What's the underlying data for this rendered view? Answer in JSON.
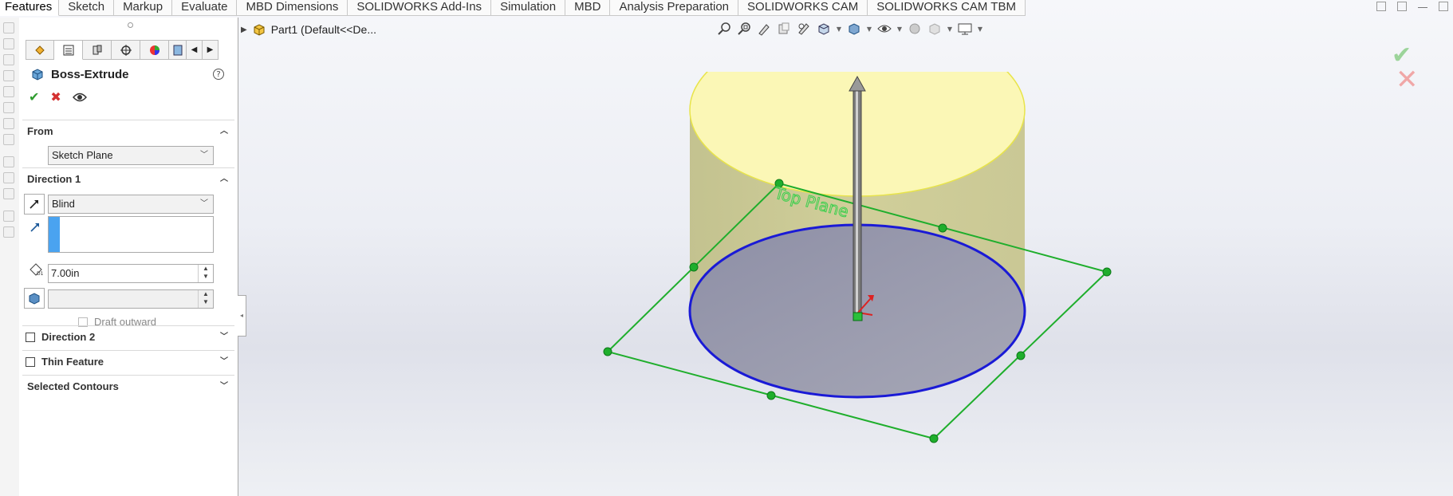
{
  "tabs": [
    "Features",
    "Sketch",
    "Markup",
    "Evaluate",
    "MBD Dimensions",
    "SOLIDWORKS Add-Ins",
    "Simulation",
    "MBD",
    "Analysis Preparation",
    "SOLIDWORKS CAM",
    "SOLIDWORKS CAM TBM"
  ],
  "active_tab": "Features",
  "property_manager": {
    "title": "Boss-Extrude",
    "help": "?",
    "from": {
      "label": "From",
      "value": "Sketch Plane"
    },
    "direction1": {
      "label": "Direction 1",
      "end_condition": "Blind",
      "depth": "7.00in",
      "draft_label": "Draft outward"
    },
    "direction2": {
      "label": "Direction 2"
    },
    "thin_feature": {
      "label": "Thin Feature"
    },
    "selected_contours": {
      "label": "Selected Contours"
    }
  },
  "tree": {
    "part_label": "Part1  (Default<<De..."
  },
  "viewport": {
    "plane_label": "Top Plane"
  },
  "colors": {
    "cylinder_top": "#fbf7b6",
    "cylinder_side": "#c5c48c",
    "base_ellipse_stroke": "#1a1ad6",
    "plane_stroke": "#1fae2c",
    "accept": "#2f9c2f",
    "cancel": "#d43131"
  },
  "icons": [
    "check-icon",
    "cross-icon",
    "eye-icon",
    "help-icon",
    "extrude-icon",
    "direction-icon",
    "depth-icon",
    "part-icon"
  ]
}
